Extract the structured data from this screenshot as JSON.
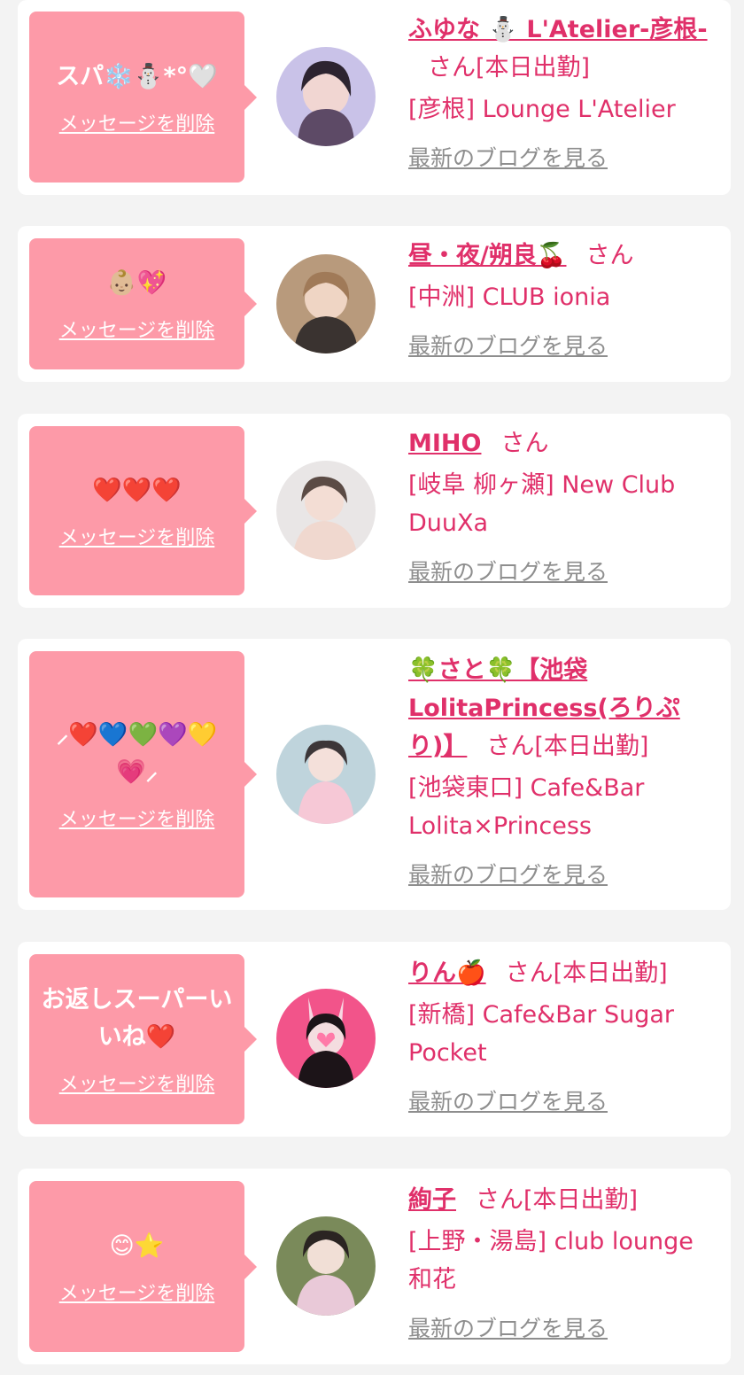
{
  "cards": [
    {
      "message": "スパ❄️⛄*°🤍",
      "delete_label": "メッセージを削除",
      "name": "ふゆな ⛄ L'Atelier-彦根-",
      "suffix": "さん[本日出勤]",
      "shop": "[彦根] Lounge L'Atelier",
      "blog_label": "最新のブログを見る",
      "avatar_colors": [
        "#c9c2e8",
        "#5d4a66"
      ]
    },
    {
      "message": "👶🏼💖",
      "delete_label": "メッセージを削除",
      "name": "昼・夜/朔良🍒",
      "suffix": "さん",
      "shop": "[中洲] CLUB ionia",
      "blog_label": "最新のブログを見る",
      "avatar_colors": [
        "#b89a7c",
        "#3a3330"
      ]
    },
    {
      "message": "❤️❤️❤️",
      "delete_label": "メッセージを削除",
      "name": "MIHO",
      "suffix": "さん",
      "shop": "[岐阜 柳ヶ瀬] New Club DuuXa",
      "blog_label": "最新のブログを見る",
      "avatar_colors": [
        "#e9e6e6",
        "#5b4b45"
      ]
    },
    {
      "message": "⸝❤️💙💚💜💛💗⸝",
      "delete_label": "メッセージを削除",
      "name": "🍀さと🍀【池袋LolitaPrincess(ろりぷり)】",
      "suffix": "さん[本日出勤]",
      "shop": "[池袋東口] Cafe&Bar Lolita×Princess",
      "blog_label": "最新のブログを見る",
      "avatar_colors": [
        "#bfd4dc",
        "#3c3638"
      ]
    },
    {
      "message": "お返しスーパーいいね❤️",
      "delete_label": "メッセージを削除",
      "name": "りん🍎",
      "suffix": "さん[本日出勤]",
      "shop": "[新橋] Cafe&Bar Sugar Pocket",
      "blog_label": "最新のブログを見る",
      "avatar_colors": [
        "#f2548a",
        "#1c1418"
      ]
    },
    {
      "message": "😊⭐",
      "delete_label": "メッセージを削除",
      "name": "絢子",
      "suffix": "さん[本日出勤]",
      "shop": "[上野・湯島] club lounge 和花",
      "blog_label": "最新のブログを見る",
      "avatar_colors": [
        "#7a8a5a",
        "#2a2422"
      ]
    }
  ]
}
